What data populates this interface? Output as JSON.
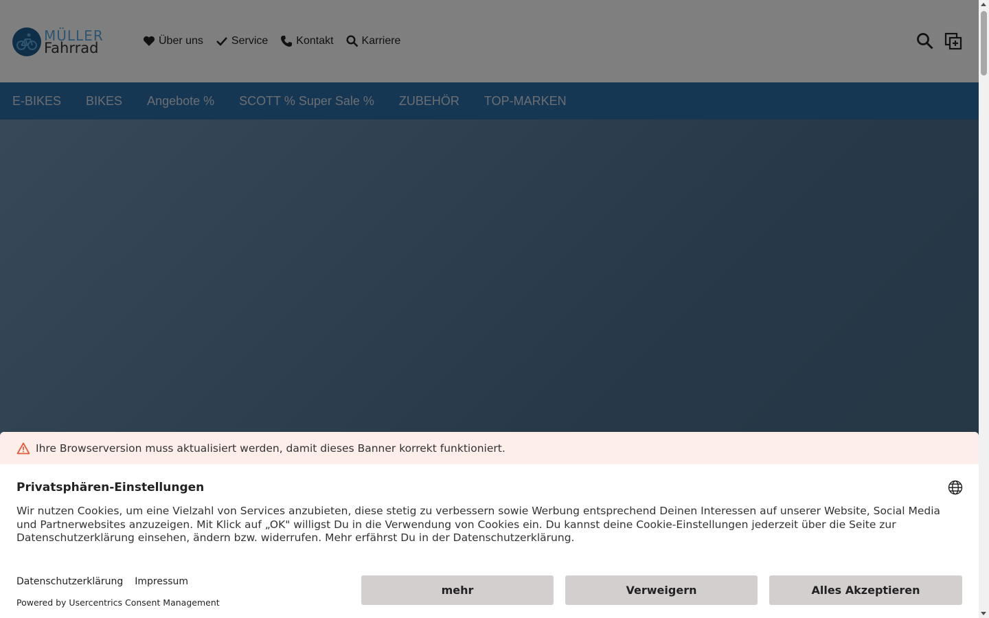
{
  "brand": {
    "line1": "MÜLLER",
    "line2": "Fahrrad"
  },
  "topnav": {
    "items": [
      {
        "label": "Über uns",
        "icon": "heart-icon"
      },
      {
        "label": "Service",
        "icon": "check-icon"
      },
      {
        "label": "Kontakt",
        "icon": "phone-icon"
      },
      {
        "label": "Karriere",
        "icon": "search-icon"
      }
    ]
  },
  "header_icons": [
    "search-icon",
    "compare-icon"
  ],
  "category_nav": {
    "items": [
      "E-BIKES",
      "BIKES",
      "Angebote %",
      "SCOTT % Super Sale %",
      "ZUBEHÖR",
      "TOP-MARKEN"
    ]
  },
  "consent": {
    "warning": "Ihre Browserversion muss aktualisiert werden, damit dieses Banner korrekt funktioniert.",
    "title": "Privatsphären-Einstellungen",
    "text": "Wir nutzen Cookies, um eine Vielzahl von Services anzubieten, diese stetig zu verbessern sowie Werbung entsprechend Deinen Interessen auf unserer Website, Social Media und Partnerwebsites anzuzeigen. Mit Klick auf „OK\" willigst Du in die Verwendung von Cookies ein. Du kannst deine Cookie-Einstellungen jederzeit über die Seite zur Datenschutzerklärung einsehen, ändern bzw. widerrufen. Mehr erfährst Du in der Datenschutzerklärung.",
    "links": [
      "Datenschutzerklärung",
      "Impressum"
    ],
    "powered": "Powered by Usercentrics Consent Management",
    "buttons": {
      "more": "mehr",
      "deny": "Verweigern",
      "accept": "Alles Akzeptieren"
    }
  },
  "colors": {
    "brand_blue": "#2c6ea8",
    "warning_bg": "#fdeee9",
    "button_bg": "#d3cfcf",
    "warning_icon": "#e05a3a"
  }
}
